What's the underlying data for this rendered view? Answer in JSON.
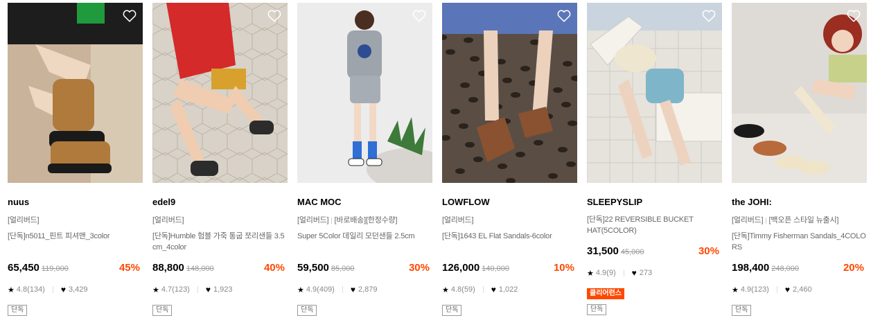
{
  "products": [
    {
      "brand": "nuus",
      "tags": [
        "[얼리버드]"
      ],
      "name": "[단독]n5011_핀트 피셔맨_3color",
      "price": "65,450",
      "original_price": "119,000",
      "discount": "45%",
      "rating": "4.8(134)",
      "likes": "3,429",
      "clearance": "",
      "exclusive": "단독",
      "scene": "sofa-fisherman",
      "colors": {
        "bg": "#c9b49b",
        "accent": "#b07a3c",
        "top": "#1d1d1d"
      }
    },
    {
      "brand": "edel9",
      "tags": [
        "[얼리버드]"
      ],
      "name": "[단독]Humble 험블 가죽 통굽 쪼리샌들 3.5cm_4color",
      "price": "88,800",
      "original_price": "148,000",
      "discount": "40%",
      "rating": "4.7(123)",
      "likes": "1,923",
      "clearance": "",
      "exclusive": "단독",
      "scene": "tile-red",
      "colors": {
        "bg": "#d8d2c8",
        "accent": "#d42a2a",
        "top": "#2c2c2c"
      }
    },
    {
      "brand": "MAC MOC",
      "tags": [
        "[얼리버드]",
        "[바로배송][한정수량]"
      ],
      "name": "Super 5Color 데일리 모던샌들 2.5cm",
      "price": "59,500",
      "original_price": "85,000",
      "discount": "30%",
      "rating": "4.9(409)",
      "likes": "2,879",
      "clearance": "",
      "exclusive": "단독",
      "scene": "studio-grey",
      "colors": {
        "bg": "#ececec",
        "accent": "#9ea4ab",
        "top": "#2f6fd6"
      }
    },
    {
      "brand": "LOWFLOW",
      "tags": [
        "[얼리버드]"
      ],
      "name": "[단독]1643 EL Flat Sandals-6color",
      "price": "126,000",
      "original_price": "140,000",
      "discount": "10%",
      "rating": "4.8(59)",
      "likes": "1,022",
      "clearance": "",
      "exclusive": "단독",
      "scene": "leopard-rug",
      "colors": {
        "bg": "#5a4e44",
        "accent": "#8a5230",
        "top": "#5a76b8"
      }
    },
    {
      "brand": "SLEEPYSLIP",
      "tags": [
        "[단독]22 REVERSIBLE BUCKET HAT(5COLOR)"
      ],
      "name": "",
      "price": "31,500",
      "original_price": "45,000",
      "discount": "30%",
      "rating": "4.9(9)",
      "likes": "273",
      "clearance": "클리어런스",
      "exclusive": "단독",
      "scene": "poolside",
      "colors": {
        "bg": "#e6e2dc",
        "accent": "#efe6cf",
        "top": "#7fb5c9"
      }
    },
    {
      "brand": "the JOHI:",
      "tags": [
        "[얼리버드]",
        "[백오픈 스타일 뉴출시]"
      ],
      "name": "[단독]Timmy Fisherman Sandals_4COLORS",
      "price": "198,400",
      "original_price": "248,000",
      "discount": "20%",
      "rating": "4.9(123)",
      "likes": "2,460",
      "clearance": "",
      "exclusive": "단독",
      "scene": "floor-sit",
      "colors": {
        "bg": "#dedbd6",
        "accent": "#b86a3b",
        "top": "#c8d18a"
      }
    }
  ]
}
